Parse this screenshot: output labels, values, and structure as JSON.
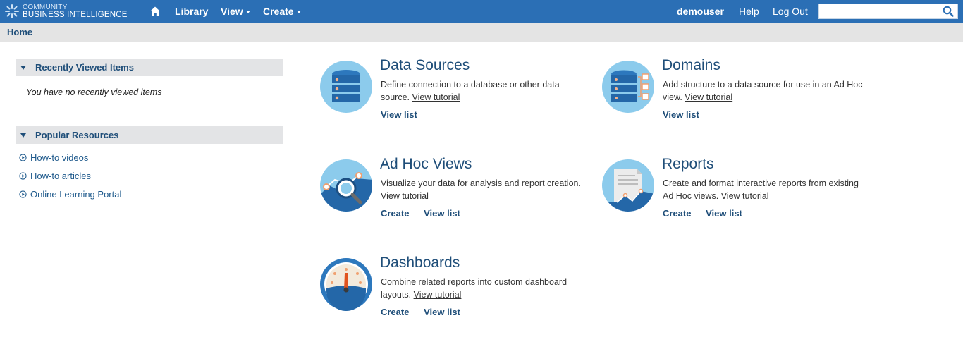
{
  "brand": {
    "line1": "COMMUNITY",
    "line2": "BUSINESS INTELLIGENCE"
  },
  "nav": {
    "library": "Library",
    "view": "View",
    "create": "Create",
    "user": "demouser",
    "help": "Help",
    "logout": "Log Out",
    "search_value": ""
  },
  "breadcrumb": "Home",
  "recent": {
    "title": "Recently Viewed Items",
    "empty_text": "You have no recently viewed items"
  },
  "popular": {
    "title": "Popular Resources",
    "links": [
      "How-to videos",
      "How-to articles",
      "Online Learning Portal"
    ]
  },
  "cards": {
    "data_sources": {
      "title": "Data Sources",
      "desc": "Define connection to a database or other data source.",
      "tutorial": "View tutorial",
      "view_list": "View list"
    },
    "domains": {
      "title": "Domains",
      "desc": "Add structure to a data source for use in an Ad Hoc view.",
      "tutorial": "View tutorial",
      "view_list": "View list"
    },
    "adhoc": {
      "title": "Ad Hoc Views",
      "desc": "Visualize your data for analysis and report creation.",
      "tutorial": "View tutorial",
      "create": "Create",
      "view_list": "View list"
    },
    "reports": {
      "title": "Reports",
      "desc": "Create and format interactive reports from existing Ad Hoc views.",
      "tutorial": "View tutorial",
      "create": "Create",
      "view_list": "View list"
    },
    "dashboards": {
      "title": "Dashboards",
      "desc": "Combine related reports into custom dashboard layouts.",
      "tutorial": "View tutorial",
      "create": "Create",
      "view_list": "View list"
    }
  },
  "colors": {
    "topbar": "#2b6fb5",
    "accent": "#1f4e79",
    "icon_bg": "#8ccbec",
    "icon_dark": "#2467a8"
  }
}
